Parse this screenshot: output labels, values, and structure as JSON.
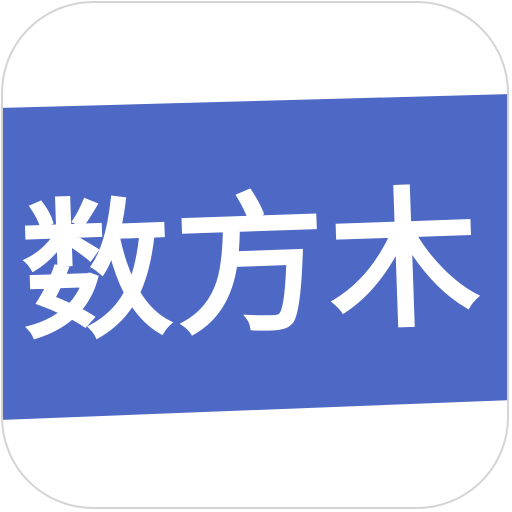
{
  "app_icon": {
    "logo_text": "数方木",
    "colors": {
      "banner": "#4e68c5",
      "text": "#ffffff",
      "background": "#ffffff",
      "border": "#d4d4d4"
    }
  }
}
